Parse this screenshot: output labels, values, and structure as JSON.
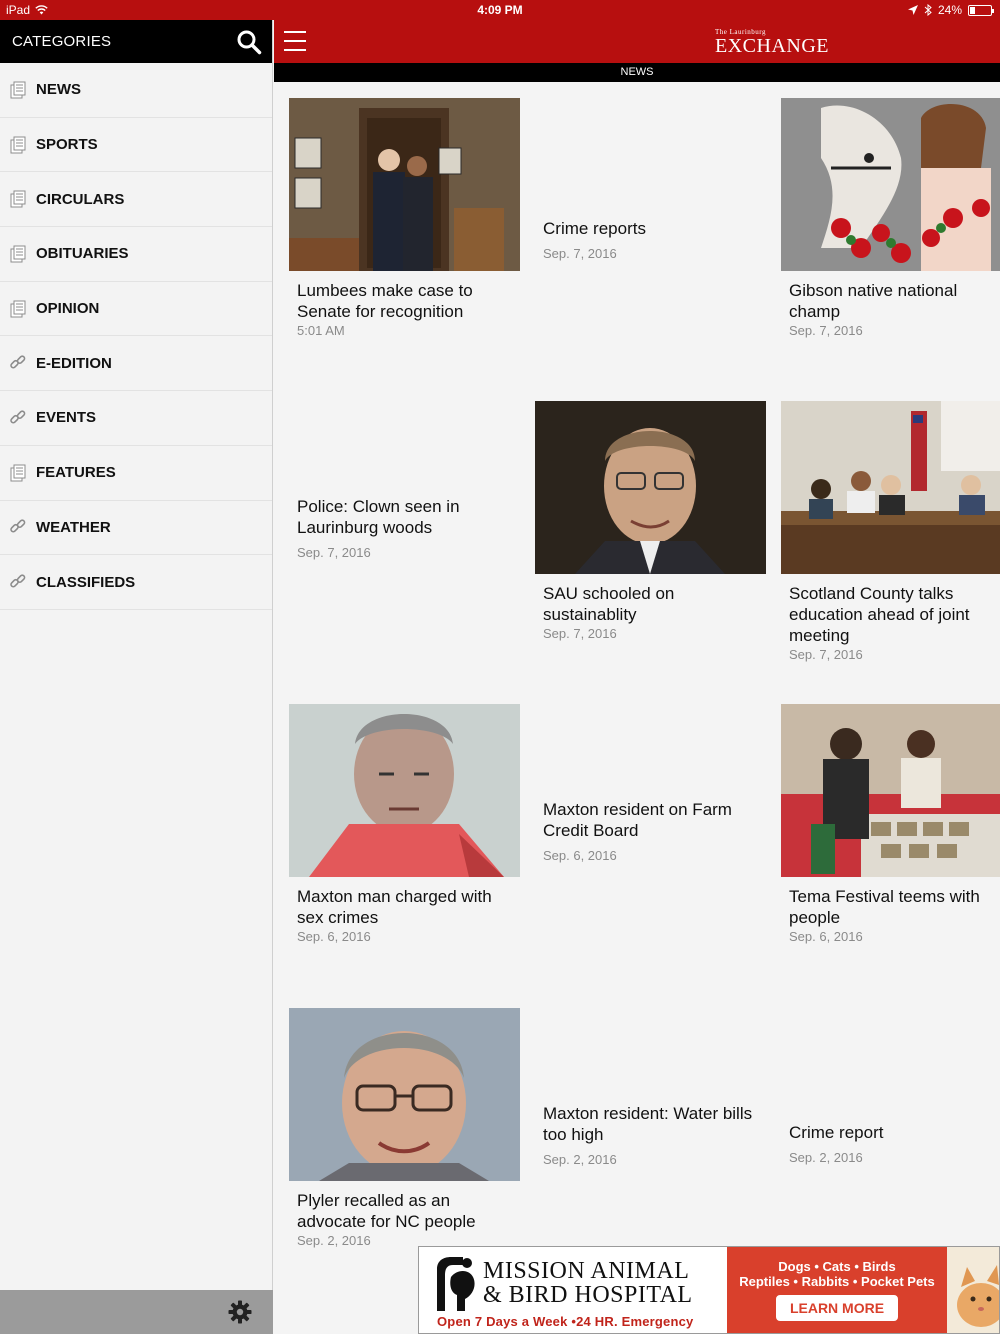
{
  "status_bar": {
    "device": "iPad",
    "time": "4:09 PM",
    "battery": "24%",
    "battery_level": 0.24
  },
  "sidebar": {
    "title": "CATEGORIES",
    "items": [
      {
        "label": "NEWS",
        "icon": "document-icon"
      },
      {
        "label": "SPORTS",
        "icon": "document-icon"
      },
      {
        "label": "CIRCULARS",
        "icon": "document-icon"
      },
      {
        "label": "OBITUARIES",
        "icon": "document-icon"
      },
      {
        "label": "OPINION",
        "icon": "document-icon"
      },
      {
        "label": "E-EDITION",
        "icon": "link-icon"
      },
      {
        "label": "EVENTS",
        "icon": "link-icon"
      },
      {
        "label": "FEATURES",
        "icon": "document-icon"
      },
      {
        "label": "WEATHER",
        "icon": "link-icon"
      },
      {
        "label": "CLASSIFIEDS",
        "icon": "link-icon"
      }
    ]
  },
  "header": {
    "logo_small": "The Laurinburg",
    "logo_big": "EXCHANGE",
    "section": "NEWS",
    "brand_color": "#b70f0f"
  },
  "articles": [
    {
      "headline": "Lumbees make case to Senate for recognition",
      "date": "5:01 AM",
      "image": "two-men-portrait-photo"
    },
    {
      "headline": "Crime reports",
      "date": "Sep. 7, 2016",
      "image": null
    },
    {
      "headline": "Gibson native national champ",
      "date": "Sep. 7, 2016",
      "image": "horse-and-woman-photo"
    },
    {
      "headline": "Police: Clown seen in Laurinburg woods",
      "date": "Sep. 7, 2016",
      "image": null
    },
    {
      "headline": "SAU schooled on sustainablity",
      "date": "Sep. 7, 2016",
      "image": "man-headshot-photo"
    },
    {
      "headline": "Scotland County talks education ahead of joint meeting",
      "date": "Sep. 7, 2016",
      "image": "board-meeting-photo"
    },
    {
      "headline": "Maxton man charged with sex crimes",
      "date": "Sep. 6, 2016",
      "image": "mugshot-photo"
    },
    {
      "headline": "Maxton resident on Farm Credit Board",
      "date": "Sep. 6, 2016",
      "image": null
    },
    {
      "headline": "Tema Festival teems with people",
      "date": "Sep. 6, 2016",
      "image": "festival-crowd-photo"
    },
    {
      "headline": "Plyler recalled as an advocate for NC people",
      "date": "Sep. 2, 2016",
      "image": "older-man-portrait-photo"
    },
    {
      "headline": "Maxton resident: Water bills too high",
      "date": "Sep. 2, 2016",
      "image": null
    },
    {
      "headline": "Crime report",
      "date": "Sep. 2, 2016",
      "image": null
    }
  ],
  "ad": {
    "name_line1": "Mission Animal",
    "name_line2": "& Bird Hospital",
    "hours": "Open 7 Days a Week •24 HR. Emergency",
    "line1": "Dogs • Cats • Birds",
    "line2": "Reptiles • Rabbits • Pocket Pets",
    "cta": "LEARN MORE"
  }
}
